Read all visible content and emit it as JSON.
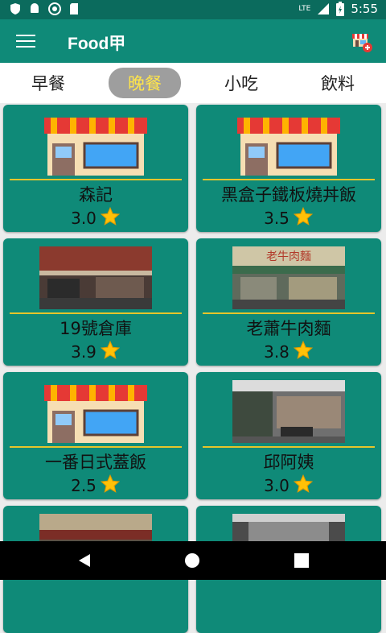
{
  "status": {
    "network": "LTE",
    "time": "5:55"
  },
  "appbar": {
    "title": "Food甲"
  },
  "tabs": [
    {
      "label": "早餐",
      "active": false
    },
    {
      "label": "晚餐",
      "active": true
    },
    {
      "label": "小吃",
      "active": false
    },
    {
      "label": "飲料",
      "active": false
    }
  ],
  "restaurants": [
    {
      "name": "森記",
      "rating": "3.0",
      "image": "storefront-illustration"
    },
    {
      "name": "黑盒子鐵板燒丼飯",
      "rating": "3.5",
      "image": "storefront-illustration"
    },
    {
      "name": "19號倉庫",
      "rating": "3.9",
      "image": "photo"
    },
    {
      "name": "老蕭牛肉麵",
      "rating": "3.8",
      "image": "photo",
      "sign_text": "老牛肉麵"
    },
    {
      "name": "一番日式蓋飯",
      "rating": "2.5",
      "image": "storefront-illustration"
    },
    {
      "name": "邱阿姨",
      "rating": "3.0",
      "image": "photo"
    },
    {
      "name": "",
      "rating": "",
      "image": "photo"
    },
    {
      "name": "",
      "rating": "",
      "image": "photo"
    }
  ],
  "colors": {
    "primary": "#0f8a78",
    "statusbar": "#0b6b5d",
    "accent": "#ffe54a",
    "divider": "#e5c52b"
  }
}
